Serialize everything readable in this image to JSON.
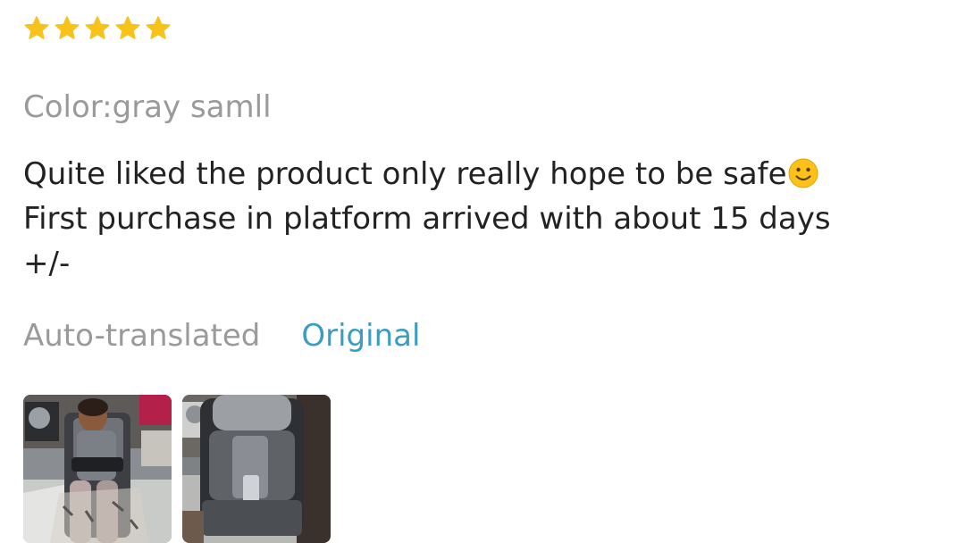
{
  "rating": {
    "value": 5,
    "max": 5,
    "star_color": "#f7c21a"
  },
  "review": {
    "color_label": "Color:gray samll",
    "text_part1": "Quite liked the product only really hope to be safe",
    "emoji": "slightly-smiling-face-icon",
    "text_part2": "First purchase in platform arrived with about 15 days +/-"
  },
  "actions": {
    "auto_translated": "Auto-translated",
    "original": "Original",
    "original_color": "#3b9cc4"
  },
  "photos": [
    {
      "name": "review-photo-child-in-seat"
    },
    {
      "name": "review-photo-seat-cushion"
    }
  ]
}
